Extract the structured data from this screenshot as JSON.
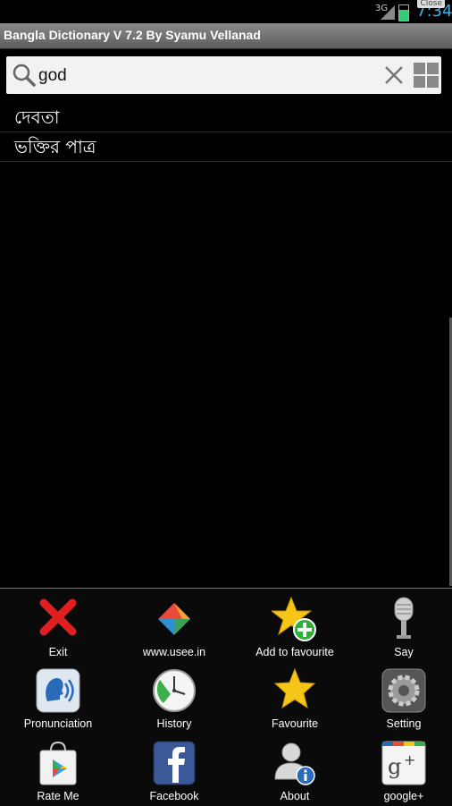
{
  "status_bar": {
    "network": "3G",
    "time": "7:34",
    "close_label": "Close"
  },
  "app": {
    "title": "Bangla Dictionary V 7.2 By Syamu Vellanad"
  },
  "search": {
    "value": "god"
  },
  "results": [
    "দেবতা",
    "ভক্তির পাত্র"
  ],
  "menu": {
    "exit": "Exit",
    "website": "www.usee.in",
    "add_favourite": "Add to favourite",
    "say": "Say",
    "pronunciation": "Pronunciation",
    "history": "History",
    "favourite": "Favourite",
    "setting": "Setting",
    "rate_me": "Rate Me",
    "facebook": "Facebook",
    "about": "About",
    "google_plus": "google+"
  },
  "icons": {
    "exit": "red-x-icon",
    "website": "usee-logo-icon",
    "add_favourite": "star-plus-icon",
    "say": "microphone-icon",
    "pronunciation": "speaker-head-icon",
    "history": "clock-icon",
    "favourite": "star-icon",
    "setting": "gear-icon",
    "rate_me": "play-store-icon",
    "facebook": "facebook-icon",
    "about": "user-info-icon",
    "google_plus": "google-plus-icon"
  },
  "colors": {
    "time": "#33b5e5",
    "title_bar": "#6f6f6f",
    "search_bg": "#f2f2f4"
  }
}
